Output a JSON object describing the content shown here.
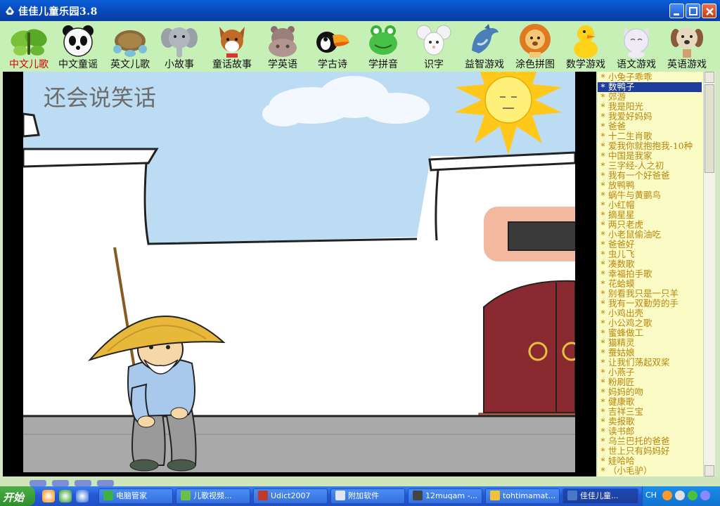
{
  "window": {
    "title": "佳佳儿童乐园3.8"
  },
  "colors": {
    "accent_active_label": "#d40000",
    "list_text": "#b8860b",
    "list_selected_bg": "#1e3d9e",
    "toolbar_bg": "#c6f0b6"
  },
  "toolbar": {
    "items": [
      {
        "label": "中文儿歌",
        "icon": "butterfly-icon",
        "active": true
      },
      {
        "label": "中文童谣",
        "icon": "panda-icon"
      },
      {
        "label": "英文儿歌",
        "icon": "turtle-icon"
      },
      {
        "label": "小故事",
        "icon": "elephant-icon"
      },
      {
        "label": "童话故事",
        "icon": "fox-icon"
      },
      {
        "label": "学英语",
        "icon": "hippo-icon"
      },
      {
        "label": "学古诗",
        "icon": "toucan-icon"
      },
      {
        "label": "学拼音",
        "icon": "frog-icon"
      },
      {
        "label": "识字",
        "icon": "mouse-icon"
      },
      {
        "label": "益智游戏",
        "icon": "dolphin-icon"
      },
      {
        "label": "涂色拼图",
        "icon": "lion-icon"
      },
      {
        "label": "数学游戏",
        "icon": "duck-icon"
      },
      {
        "label": "语文游戏",
        "icon": "cat-icon"
      },
      {
        "label": "英语游戏",
        "icon": "dog-icon"
      }
    ]
  },
  "stage": {
    "title": "还会说笑话"
  },
  "playlist": {
    "items": [
      "小兔子乖乖",
      "数鸭子",
      "郊游",
      "我是阳光",
      "我爱好妈妈",
      "爸爸",
      "十二生肖歌",
      "爱我你就抱抱我-10种",
      "中国是我家",
      "三字经-人之初",
      "我有一个好爸爸",
      "放鸭鸭",
      "蜗牛与黄鹂鸟",
      "小红帽",
      "摘星星",
      "两只老虎",
      "小老鼠偷油吃",
      "爸爸好",
      "虫儿飞",
      "凑数歌",
      "幸福拍手歌",
      "花蛤蟆",
      "别看我只是一只羊",
      "我有一双勤劳的手",
      "小鸡出壳",
      "小公鸡之歌",
      "蜜蜂做工",
      "猫精灵",
      "蚕姑娘",
      "让我们荡起双桨",
      "小燕子",
      "粉刷匠",
      "妈妈的吻",
      "健康歌",
      "吉祥三宝",
      "卖报歌",
      "读书郎",
      "乌兰巴托的爸爸",
      "世上只有妈妈好",
      "娃哈哈",
      "（小毛驴）"
    ],
    "selected_index": 1
  },
  "taskbar": {
    "start_label": "开始",
    "tasks": [
      {
        "label": "电脑管家",
        "icon": "shield-icon",
        "color": "#3cb043"
      },
      {
        "label": "儿歌视频...",
        "icon": "browser-icon",
        "color": "#6cc04a"
      },
      {
        "label": "Udict2007",
        "icon": "book-icon",
        "color": "#c0392b"
      },
      {
        "label": "附加软件",
        "icon": "window-icon",
        "color": "#dfe6f3"
      },
      {
        "label": "12muqam -...",
        "icon": "film-icon",
        "color": "#444444"
      },
      {
        "label": "tohtimamat...",
        "icon": "folder-icon",
        "color": "#f0c040"
      },
      {
        "label": "佳佳儿童...",
        "icon": "app-icon",
        "color": "#4a78c8"
      }
    ],
    "tray_text": "CH"
  }
}
